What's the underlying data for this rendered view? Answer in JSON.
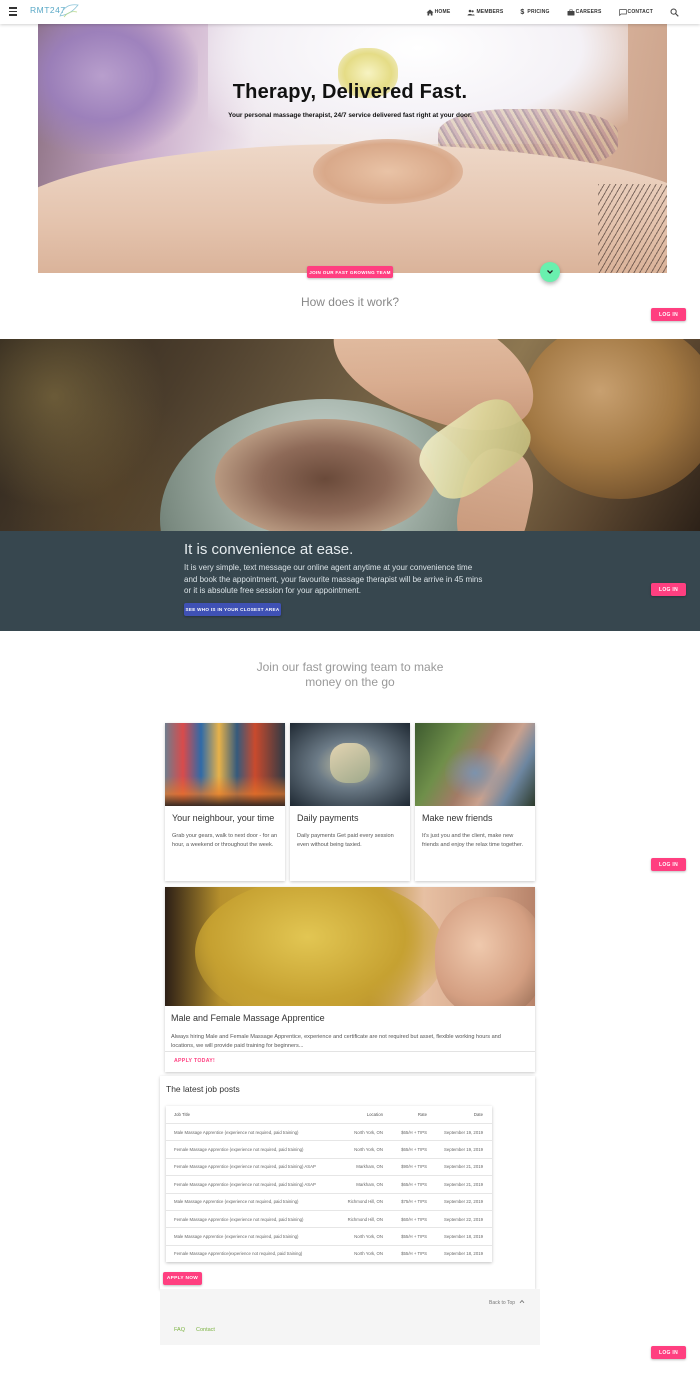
{
  "nav": {
    "brand": "RMT247",
    "items": [
      {
        "label": "HOME",
        "icon": "home-icon"
      },
      {
        "label": "MEMBERS",
        "icon": "members-icon"
      },
      {
        "label": "PRICING",
        "icon": "dollar-icon"
      },
      {
        "label": "CAREERS",
        "icon": "briefcase-icon"
      },
      {
        "label": "CONTACT",
        "icon": "message-icon"
      }
    ]
  },
  "hero": {
    "title": "Therapy, Delivered Fast.",
    "subtitle": "Your personal massage therapist, 24/7 service delivered fast right at your door.",
    "join_button": "JOIN OUR FAST GROWING TEAM"
  },
  "how": {
    "title": "How does it work?"
  },
  "login_label": "LOG IN",
  "convenience": {
    "title": "It is convenience at ease.",
    "text": "It is very simple, text message our online agent anytime at your convenience time and book the appointment, your favourite massage therapist will be arrive in 45 mins or it is absolute free session for your appointment.",
    "button": "SEE WHO IS IN YOUR CLOSEST AREA"
  },
  "join_team": {
    "title": "Join our fast growing team to make money on the go"
  },
  "cards": [
    {
      "title": "Your neighbour, your time",
      "text": "Grab your gears, walk to next door - for an hour, a weekend or throughout the week."
    },
    {
      "title": "Daily payments",
      "text": "Daily payments Get paid every session even without being taxied."
    },
    {
      "title": "Make new friends",
      "text": "It's just you and the client, make new friends and enjoy the relax time together."
    }
  ],
  "apprentice": {
    "title": "Male and Female Massage Apprentice",
    "text": "Always hiring Male and Female Massage Apprentice, experience and certificate are not required but asset, flexible working hours and locations, we will provide paid training for beginners...",
    "apply": "APPLY TODAY!"
  },
  "jobs": {
    "title": "The latest job posts",
    "columns": [
      "Job Title",
      "Location",
      "Rate",
      "Date"
    ],
    "rows": [
      [
        "Male Massage Apprentice (experience not required, paid training)",
        "North York, ON",
        "$65/H + TIPS",
        "September 19, 2019"
      ],
      [
        "Female Massage Apprentice (experience not required, paid training)",
        "North York, ON",
        "$65/H + TIPS",
        "September 19, 2019"
      ],
      [
        "Female Massage Apprentice (experience not required, paid training) ASAP",
        "Markham, ON",
        "$90/H + TIPS",
        "September 21, 2019"
      ],
      [
        "Female Massage Apprentice (experience not required, paid training) ASAP",
        "Markham, ON",
        "$65/H + TIPS",
        "September 21, 2019"
      ],
      [
        "Male Massage Apprentice (experience not required, paid training)",
        "Richmond Hill, ON",
        "$75/H + TIPS",
        "September 22, 2019"
      ],
      [
        "Female Massage Apprentice (experience not required, paid training)",
        "Richmond Hill, ON",
        "$60/H + TIPS",
        "September 22, 2019"
      ],
      [
        "Male Massage Apprentice (experience not required, paid training)",
        "North York, ON",
        "$55/H + TIPS",
        "September 18, 2019"
      ],
      [
        "Female Massage Apprentice(experience not required, paid training)",
        "North York, ON",
        "$55/H + TIPS",
        "September 18, 2019"
      ]
    ],
    "apply_now": "APPLY NOW"
  },
  "footer": {
    "back_to_top": "Back to Top",
    "links": [
      "FAQ",
      "Contact"
    ]
  }
}
